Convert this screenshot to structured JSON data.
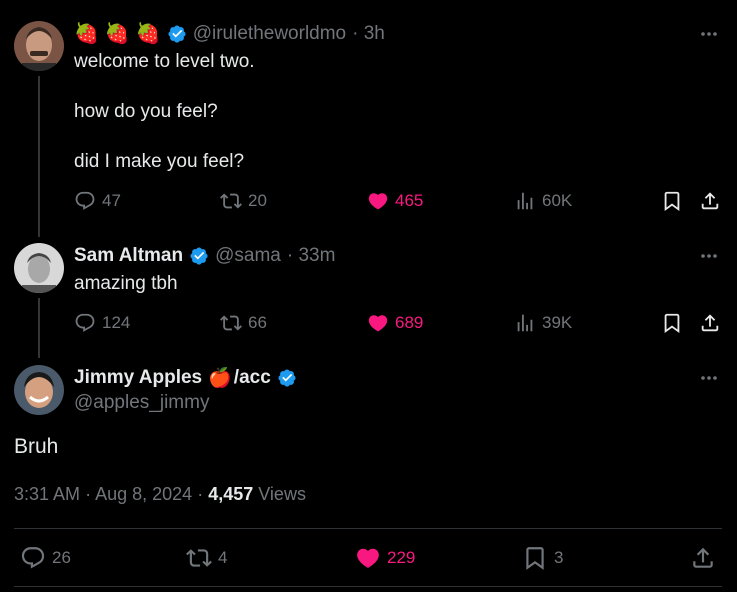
{
  "colors": {
    "background": "#000000",
    "text": "#e7e9ea",
    "muted": "#71767b",
    "like": "#f91880",
    "verified": "#1d9bf0"
  },
  "tweet1": {
    "emoji": [
      "🍓",
      "🍓",
      "🍓"
    ],
    "handle": "@irulethe​worldmo",
    "time": "· 3h",
    "lines": [
      "welcome to level two.",
      "how do you feel?",
      "did I make you feel?"
    ],
    "replies": "47",
    "retweets": "20",
    "likes": "465",
    "views": "60K"
  },
  "tweet2": {
    "name": "Sam Altman",
    "handle": "@sama",
    "time": "· 33m",
    "text": "amazing tbh",
    "replies": "124",
    "retweets": "66",
    "likes": "689",
    "views": "39K"
  },
  "main": {
    "name": "Jimmy Apples",
    "name_emoji": "🍎",
    "name_suffix": "/acc",
    "handle": "@apples_jimmy",
    "text": "Bruh",
    "time": "3:31 AM",
    "date": "Aug 8, 2024",
    "views_count": "4,457",
    "views_label": "Views",
    "replies": "26",
    "retweets": "4",
    "likes": "229",
    "bookmarks": "3"
  }
}
